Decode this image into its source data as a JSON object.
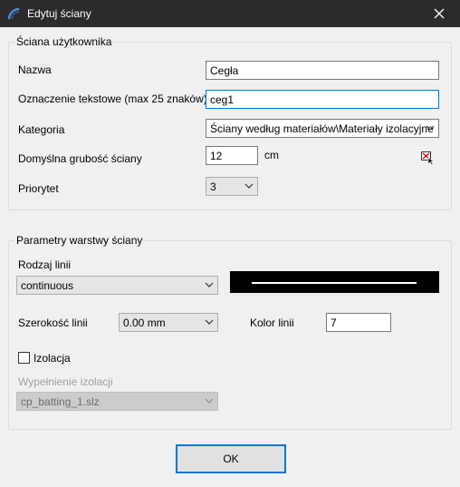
{
  "window": {
    "title": "Edytuj ściany",
    "icon": "app-arc-icon",
    "close_icon": "close-icon"
  },
  "group_user": {
    "legend": "Ściana użytkownika",
    "name_label": "Nazwa",
    "name_value": "Cegła",
    "tag_label": "Oznaczenie tekstowe (max 25 znaków)",
    "tag_value": "ceg1",
    "category_label": "Kategoria",
    "category_value": "Ściany według materiałów\\Materiały izolacyjne",
    "thickness_label": "Domyślna grubość ściany",
    "thickness_value": "12",
    "thickness_unit": "cm",
    "pick_icon": "pick-from-drawing-icon",
    "priority_label": "Priorytet",
    "priority_value": "3"
  },
  "group_layer": {
    "legend": "Parametry warstwy ściany",
    "linetype_label": "Rodzaj linii",
    "linetype_value": "continuous",
    "linewidth_label": "Szerokość linii",
    "linewidth_value": "0.00 mm",
    "linecolor_label": "Kolor linii",
    "linecolor_value": "7",
    "insulation_label": "Izolacja",
    "insulation_checked": false,
    "fill_label": "Wypełnienie izolacji",
    "fill_value": "cp_batting_1.slz",
    "preview_bg": "#000000",
    "preview_line": "#ffffff"
  },
  "buttons": {
    "ok": "OK"
  }
}
